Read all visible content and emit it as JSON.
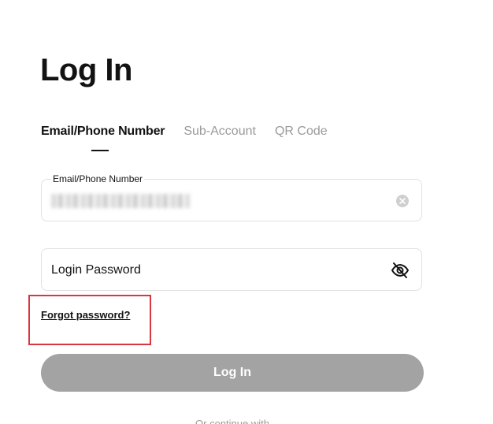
{
  "page": {
    "title": "Log In"
  },
  "tabs": [
    {
      "label": "Email/Phone Number",
      "active": true
    },
    {
      "label": "Sub-Account",
      "active": false
    },
    {
      "label": "QR Code",
      "active": false
    }
  ],
  "email_field": {
    "label": "Email/Phone Number",
    "value_obscured": true,
    "clear_icon": "clear-circle-icon"
  },
  "password_field": {
    "placeholder": "Login Password",
    "toggle_icon": "eye-off-icon"
  },
  "forgot_password": {
    "label": "Forgot password?"
  },
  "login_button": {
    "label": "Log In"
  },
  "footer": {
    "continue_text": "Or continue with"
  },
  "colors": {
    "primary_text": "#121212",
    "muted_text": "#9a9a9a",
    "button_disabled": "#a3a3a3",
    "highlight": "#d9363e"
  }
}
